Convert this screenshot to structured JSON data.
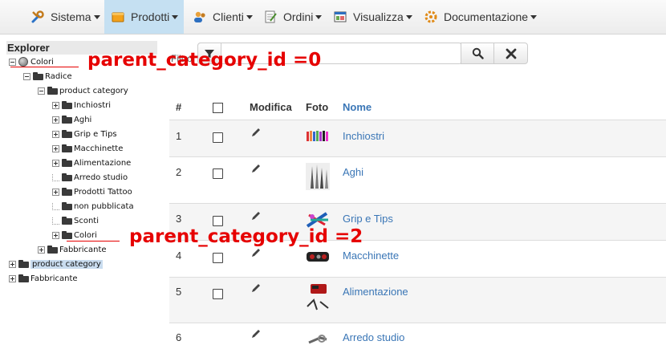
{
  "menu": {
    "items": [
      {
        "label": "Sistema",
        "icon": "wrench-icon"
      },
      {
        "label": "Prodotti",
        "icon": "box-icon"
      },
      {
        "label": "Clienti",
        "icon": "users-icon"
      },
      {
        "label": "Ordini",
        "icon": "order-icon"
      },
      {
        "label": "Visualizza",
        "icon": "window-icon"
      },
      {
        "label": "Documentazione",
        "icon": "help-icon"
      }
    ],
    "active": "Prodotti"
  },
  "explorer": {
    "title": "Explorer",
    "nodes": [
      {
        "label": "Colori"
      },
      {
        "label": "Radice"
      },
      {
        "label": "product category"
      },
      {
        "label": "Inchiostri"
      },
      {
        "label": "Aghi"
      },
      {
        "label": "Grip e Tips"
      },
      {
        "label": "Macchinette"
      },
      {
        "label": "Alimentazione"
      },
      {
        "label": "Arredo studio"
      },
      {
        "label": "Prodotti Tattoo"
      },
      {
        "label": "non pubblicata"
      },
      {
        "label": "Sconti"
      },
      {
        "label": "Colori"
      },
      {
        "label": "Fabbricante"
      },
      {
        "label": "product category"
      },
      {
        "label": "Fabbricante"
      }
    ]
  },
  "annotations": {
    "top": "parent_category_id =0",
    "bottom": "parent_category_id =2",
    "color": "#e60000"
  },
  "filter": {
    "label": "Filtro"
  },
  "table": {
    "headers": {
      "num": "#",
      "edit": "Modifica",
      "photo": "Foto",
      "name": "Nome"
    },
    "rows": [
      {
        "num": "1",
        "name": "Inchiostri"
      },
      {
        "num": "2",
        "name": "Aghi"
      },
      {
        "num": "3",
        "name": "Grip e Tips"
      },
      {
        "num": "4",
        "name": "Macchinette"
      },
      {
        "num": "5",
        "name": "Alimentazione"
      },
      {
        "num": "6",
        "name": "Arredo studio"
      }
    ]
  },
  "colors": {
    "link": "#3a76b6",
    "active_menu": "#c5e0f2",
    "selected_node": "#c9dcef"
  }
}
